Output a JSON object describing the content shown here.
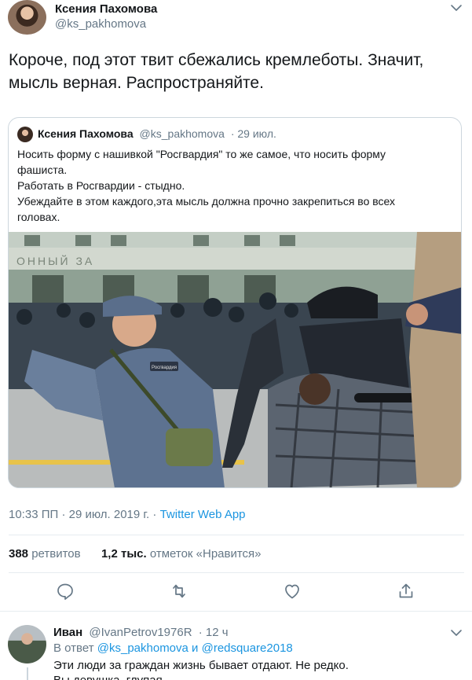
{
  "tweet": {
    "author_name": "Ксения Пахомова",
    "author_handle": "@ks_pakhomova",
    "text_line1": "Короче, под этот твит сбежались кремлеботы. Значит,",
    "text_line2": "мысль верная. Распространяйте.",
    "timestamp": "10:33 ПП",
    "date": "29 июл. 2019 г.",
    "meta_separator": "·",
    "app": "Twitter Web App",
    "retweets_count": "388",
    "retweets_label": "ретвитов",
    "likes_count": "1,2 тыс.",
    "likes_label": "отметок «Нравится»"
  },
  "quoted_tweet": {
    "author_name": "Ксения Пахомова",
    "author_handle": "@ks_pakhomova",
    "date": "· 29 июл.",
    "lines": [
      "Носить форму с нашивкой \"Росгвардия\" то же самое, что носить форму",
      "фашиста.",
      "Работать в Росгвардии - стыдно.",
      "Убеждайте в этом каждого,эта мысль должна прочно закрепиться во всех",
      "головах."
    ],
    "photo_patch_text": "Росгвардия",
    "photo_sign_text": "ОННЫЙ ЗА"
  },
  "actions": {
    "reply_icon": "reply-icon",
    "retweet_icon": "retweet-icon",
    "like_icon": "heart-icon",
    "share_icon": "share-icon"
  },
  "reply": {
    "author_name": "Иван",
    "author_handle": "@IvanPetrov1976R",
    "time": "· 12 ч",
    "in_reply_prefix": "В ответ",
    "mention1": "@ks_pakhomova",
    "conj": "и",
    "mention2": "@redsquare2018",
    "text_line1": "Эти люди за граждан жизнь бывает отдают. Не редко.",
    "text_line2": "Вы девушка, глупая."
  },
  "colors": {
    "link": "#1b95e0",
    "secondary_text": "#657786",
    "border": "#ccd6dd"
  }
}
